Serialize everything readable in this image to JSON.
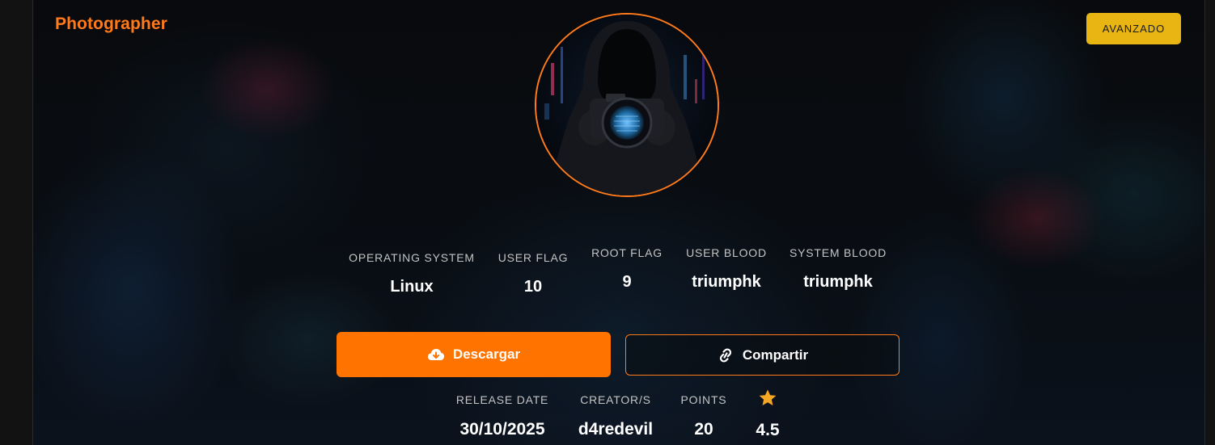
{
  "machine": {
    "name": "Photographer",
    "difficulty": "AVANZADO"
  },
  "stats": [
    {
      "label": "OPERATING SYSTEM",
      "value": "Linux"
    },
    {
      "label": "USER FLAG",
      "value": "10"
    },
    {
      "label": "ROOT FLAG",
      "value": "9"
    },
    {
      "label": "USER BLOOD",
      "value": "triumphk"
    },
    {
      "label": "SYSTEM BLOOD",
      "value": "triumphk"
    }
  ],
  "actions": {
    "download_label": "Descargar",
    "download_icon": "cloud-download-icon",
    "share_label": "Compartir",
    "share_icon": "link-icon"
  },
  "details": [
    {
      "label": "RELEASE DATE",
      "value": "30/10/2025"
    },
    {
      "label": "CREATOR/S",
      "value": "d4redevil"
    },
    {
      "label": "POINTS",
      "value": "20"
    },
    {
      "label": "",
      "icon": "star-icon",
      "value": "4.5"
    }
  ],
  "colors": {
    "accent": "#ff7300",
    "title": "#ff7a1a",
    "badge": "#e8b512",
    "star": "#f5a623"
  }
}
